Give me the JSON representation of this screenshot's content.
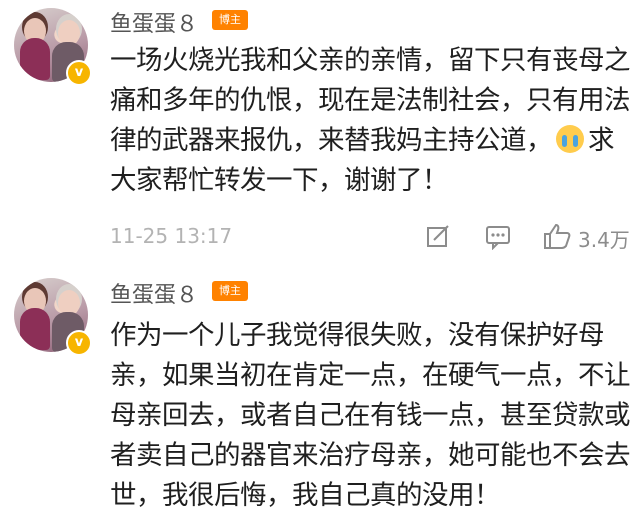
{
  "comments": [
    {
      "username": "鱼蛋蛋８",
      "badge": "博主",
      "text_before": "一场火烧光我和父亲的亲情，留下只有丧母之痛和多年的仇恨，现在是法制社会，只有用法律的武器来报仇，来替我妈主持公道，",
      "emoji": "crying-face-emoji",
      "text_after": "求大家帮忙转发一下，谢谢了！",
      "time": "11-25 13:17",
      "likes": "3.4万"
    },
    {
      "username": "鱼蛋蛋８",
      "badge": "博主",
      "text": "作为一个儿子我觉得很失败，没有保护好母亲，如果当初在肯定一点，在硬气一点，不让母亲回去，或者自己在有钱一点，甚至贷款或者卖自己的器官来治疗母亲，她可能也不会去世，我很后悔，我自己真的没用！"
    }
  ],
  "colors": {
    "badge": "#ff8200",
    "verified": "#f7b500",
    "meta": "#b3b3b3"
  }
}
